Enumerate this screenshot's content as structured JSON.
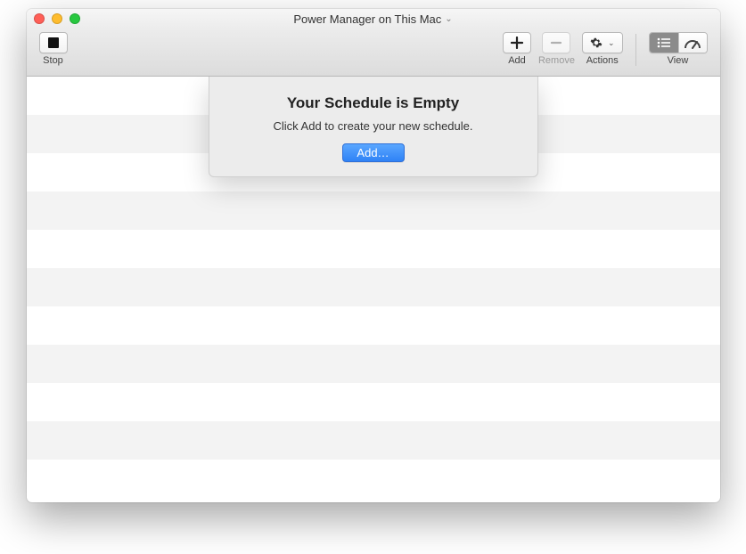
{
  "window": {
    "title": "Power Manager on This Mac"
  },
  "toolbar": {
    "stop_label": "Stop",
    "add_label": "Add",
    "remove_label": "Remove",
    "actions_label": "Actions",
    "view_label": "View"
  },
  "empty_state": {
    "title": "Your Schedule is Empty",
    "message": "Click Add to create your new schedule.",
    "button": "Add…"
  }
}
